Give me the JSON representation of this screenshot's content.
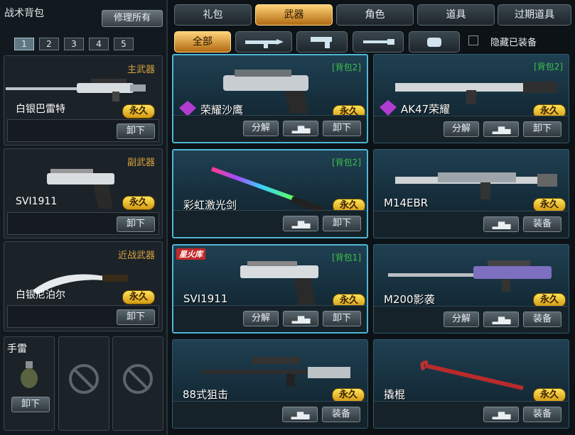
{
  "header": {
    "title": "战术背包",
    "repair_all": "修理所有",
    "pages": [
      "1",
      "2",
      "3",
      "4",
      "5"
    ],
    "active_page": "1"
  },
  "tabs": [
    {
      "label": "礼包"
    },
    {
      "label": "武器",
      "active": true
    },
    {
      "label": "角色"
    },
    {
      "label": "道具"
    },
    {
      "label": "过期道具"
    }
  ],
  "filters": {
    "all": "全部",
    "hide_equipped": "隐藏已装备"
  },
  "slots": {
    "primary": {
      "caption": "主武器",
      "name": "白银巴雷特",
      "status": "永久",
      "unequip": "卸下"
    },
    "secondary": {
      "caption": "副武器",
      "name": "SVI1911",
      "status": "永久",
      "unequip": "卸下"
    },
    "melee": {
      "caption": "近战武器",
      "name": "白银尼泊尔",
      "status": "永久",
      "unequip": "卸下"
    },
    "grenade": {
      "caption": "手雷",
      "unequip": "卸下"
    }
  },
  "items": [
    {
      "name": "荣耀沙鹰",
      "bag": "[背包2]",
      "status": "永久",
      "actions": [
        "分解",
        "卸下"
      ],
      "glory": true
    },
    {
      "name": "AK47荣耀",
      "bag": "[背包2]",
      "status": "永久",
      "actions": [
        "分解",
        "卸下"
      ],
      "glory": true
    },
    {
      "name": "彩虹激光剑",
      "bag": "[背包2]",
      "status": "永久",
      "actions": [
        "卸下"
      ]
    },
    {
      "name": "M14EBR",
      "bag": "",
      "status": "永久",
      "actions": [
        "装备"
      ]
    },
    {
      "name": "SVI1911",
      "bag": "[背包1]",
      "status": "永久",
      "actions": [
        "分解",
        "卸下"
      ],
      "badge": "星火库"
    },
    {
      "name": "M200影袭",
      "bag": "",
      "status": "永久",
      "actions": [
        "分解",
        "装备"
      ]
    },
    {
      "name": "88式狙击",
      "bag": "",
      "status": "永久",
      "actions": [
        "装备"
      ]
    },
    {
      "name": "撬棍",
      "bag": "",
      "status": "永久",
      "actions": [
        "装备"
      ]
    }
  ],
  "stats_glyph": "▂▆▄",
  "colors": {
    "accent": "#4fb6d6",
    "gold": "#f0c020",
    "bag_green": "#3ec24a"
  }
}
